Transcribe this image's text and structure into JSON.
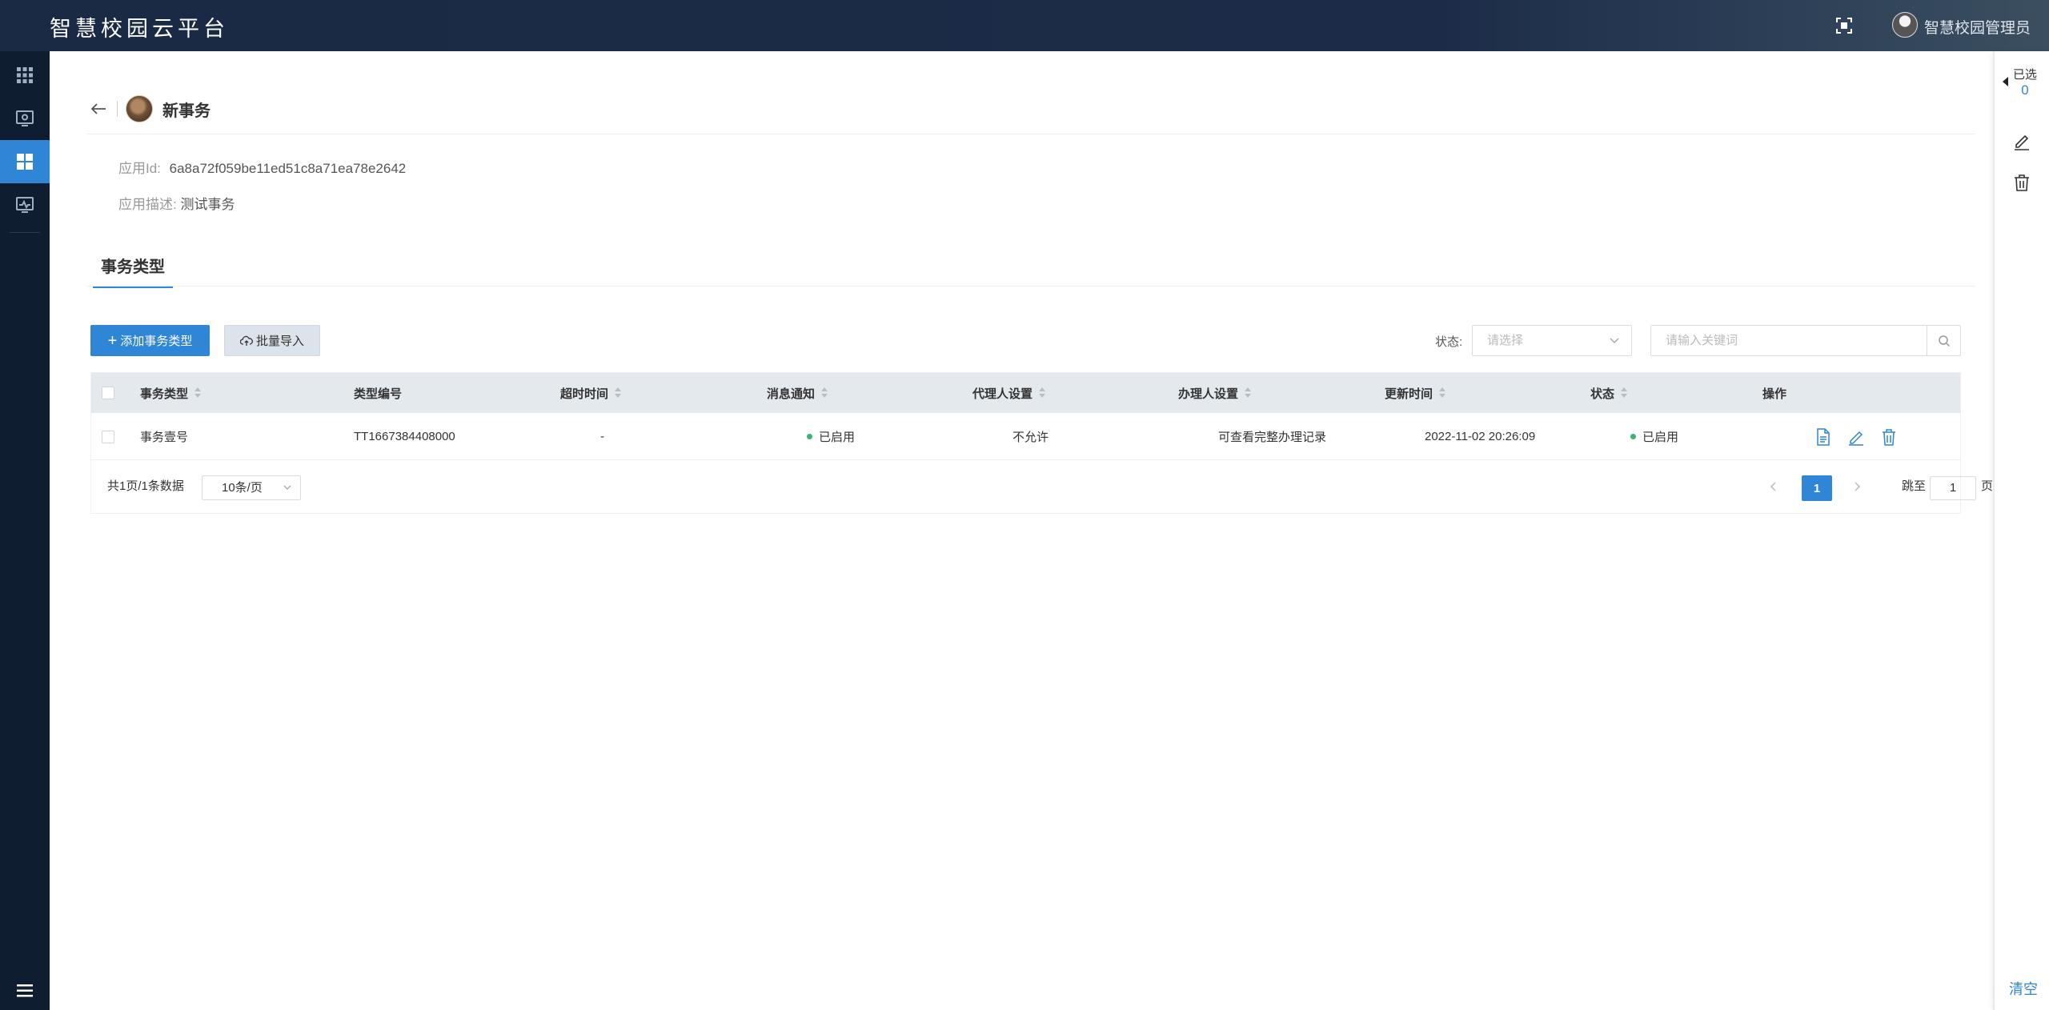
{
  "header": {
    "title": "智慧校园云平台",
    "user_name": "智慧校园管理员"
  },
  "right_panel": {
    "selected_label": "已选",
    "selected_count": "0",
    "clear_label": "清空"
  },
  "app": {
    "name": "新事务",
    "id_label": "应用Id:",
    "id_value": "6a8a72f059be11ed51c8a71ea78e2642",
    "desc_label": "应用描述:",
    "desc_value": "测试事务"
  },
  "tabs": [
    {
      "label": "事务类型"
    }
  ],
  "toolbar": {
    "add_label": "添加事务类型",
    "import_label": "批量导入",
    "status_label": "状态:",
    "status_placeholder": "请选择",
    "search_placeholder": "请输入关键词"
  },
  "table": {
    "columns": [
      "事务类型",
      "类型编号",
      "超时时间",
      "消息通知",
      "代理人设置",
      "办理人设置",
      "更新时间",
      "状态",
      "操作"
    ],
    "rows": [
      {
        "type": "事务壹号",
        "code": "TT1667384408000",
        "timeout": "-",
        "notify": "已启用",
        "agent": "不允许",
        "handler": "可查看完整办理记录",
        "updated": "2022-11-02 20:26:09",
        "status": "已启用"
      }
    ]
  },
  "pagination": {
    "total_text": "共1页/1条数据",
    "page_size": "10条/页",
    "current_page": "1",
    "jump_label": "跳至",
    "jump_value": "1",
    "jump_suffix": "页"
  },
  "colors": {
    "topbar": "#1c2c48",
    "sidebar": "#0f1d30",
    "accent": "#2f86d6",
    "enabled_dot": "#3cb371"
  }
}
